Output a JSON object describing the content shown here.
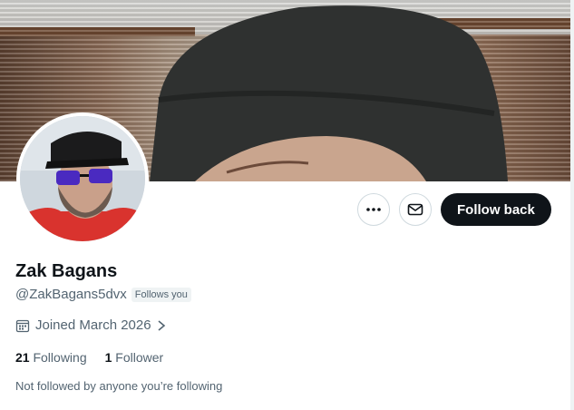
{
  "profile": {
    "display_name": "Zak Bagans",
    "handle": "@ZakBagans5dvx",
    "follows_you_badge": "Follows you",
    "joined": "Joined March 2026",
    "following_count": "21",
    "following_label": "Following",
    "followers_count": "1",
    "followers_label": "Follower",
    "mutuals_note": "Not followed by anyone you’re following"
  },
  "actions": {
    "more_icon": "more-horizontal-icon",
    "message_icon": "envelope-icon",
    "follow_back_label": "Follow back"
  },
  "icons": {
    "calendar": "calendar-icon",
    "chevron": "chevron-right-icon"
  },
  "colors": {
    "primary_text": "#0f1419",
    "secondary_text": "#536471",
    "button_dark": "#0f1419",
    "border": "#cfd9de"
  }
}
